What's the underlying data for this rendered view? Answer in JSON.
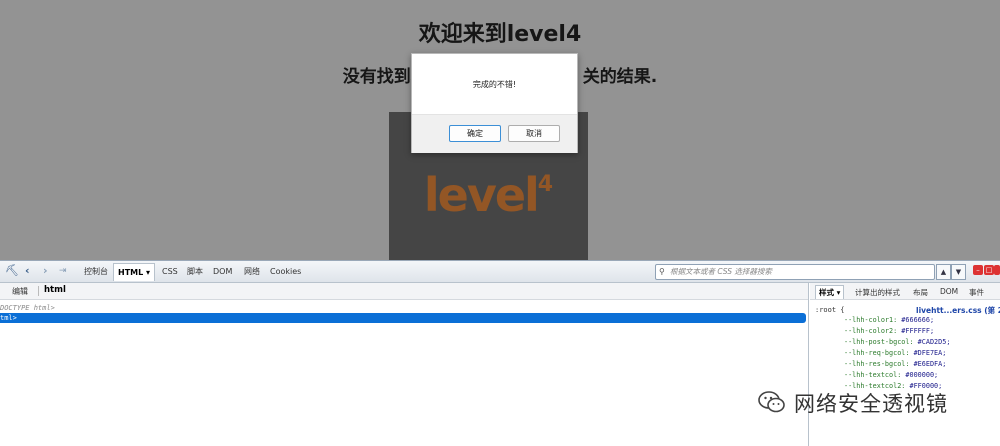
{
  "page": {
    "title": "欢迎来到level4",
    "subtitle": "没有找到和",
    "subtitle_tail": "关的结果.",
    "logo_text": "level",
    "logo_sup": "4"
  },
  "alert": {
    "message": "完成的不错!",
    "ok_label": "确定",
    "cancel_label": "取消"
  },
  "devtools": {
    "panel_tabs": [
      "控制台",
      "HTML",
      "CSS",
      "脚本",
      "DOM",
      "网络",
      "Cookies"
    ],
    "active_tab": "HTML",
    "search_placeholder": "根据文本或者 CSS 选择器搜索",
    "html_panel": {
      "edit_label": "编辑",
      "breadcrumb": "html",
      "doctype": "DOCTYPE html>",
      "selected_line": "tml>"
    },
    "style_panel": {
      "tabs": [
        "样式",
        "计算出的样式",
        "布局",
        "DOM",
        "事件"
      ],
      "selector": ":root {",
      "file": "livehtt...ers.css (第 2 行",
      "properties": [
        {
          "name": "--lhh-color1:",
          "value": "#666666;"
        },
        {
          "name": "--lhh-color2:",
          "value": "#FFFFFF;"
        },
        {
          "name": "--lhh-post-bgcol:",
          "value": "#CAD2D5;"
        },
        {
          "name": "--lhh-req-bgcol:",
          "value": "#DFE7EA;"
        },
        {
          "name": "--lhh-res-bgcol:",
          "value": "#E6EDFA;"
        },
        {
          "name": "--lhh-textcol:",
          "value": "#000000;"
        },
        {
          "name": "--lhh-textcol2:",
          "value": "#FF0000;"
        }
      ]
    }
  },
  "watermark": {
    "text": "网络安全透视镜"
  },
  "colors": {
    "logo": "#ff8a2c",
    "selection": "#0b6fd6",
    "ok_border": "#3c8fd6"
  }
}
